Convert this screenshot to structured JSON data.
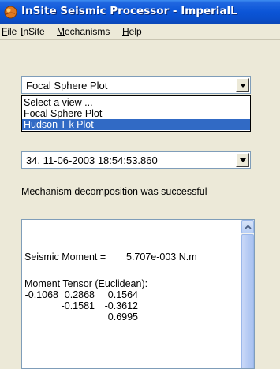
{
  "window": {
    "title": "InSite Seismic Processor - ImperialL"
  },
  "menu": {
    "items": [
      {
        "key": "F",
        "rest": "ile"
      },
      {
        "key": "I",
        "rest": "nSite"
      },
      {
        "key": "M",
        "rest": "echanisms"
      },
      {
        "key": "H",
        "rest": "elp"
      }
    ]
  },
  "view_select": {
    "selected": "Focal Sphere Plot",
    "options": [
      "Select a view ...",
      "Focal Sphere Plot",
      "Hudson T-k Plot"
    ],
    "highlighted_option": "Hudson T-k Plot"
  },
  "event_select": {
    "selected": "34.  11-06-2003  18:54:53.860"
  },
  "status": {
    "message": "Mechanism decomposition was successful"
  },
  "results": {
    "seismic_moment_label": "Seismic Moment =",
    "seismic_moment_value": "5.707e-003 N.m",
    "tensor_label": "Moment Tensor (Euclidean):",
    "tensor_rows": [
      [
        "-0.1068",
        "0.2868",
        "0.1564"
      ],
      [
        "",
        "-0.1581",
        "-0.3612"
      ],
      [
        "",
        "",
        "0.6995"
      ]
    ]
  },
  "colors": {
    "title_bar": "#0b55d7",
    "selection": "#316ac5",
    "window_bg": "#ece9d8",
    "field_border": "#7f9db9"
  },
  "icons": {
    "app": "app-icon",
    "dropdown": "chevron-down-icon",
    "scroll_up": "arrow-up-icon"
  }
}
